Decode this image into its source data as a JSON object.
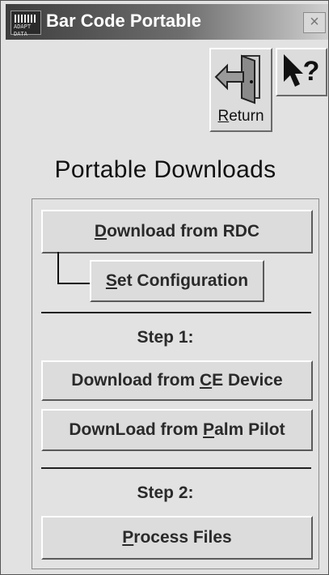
{
  "window": {
    "title": "Bar Code Portable",
    "icon_text": "ADAPT DATA",
    "close_glyph": "×"
  },
  "toolbar": {
    "return_prefix": "",
    "return_underlined": "R",
    "return_rest": "eturn",
    "help_glyph": "?"
  },
  "heading": "Portable Downloads",
  "buttons": {
    "download_rdc": {
      "underlined": "D",
      "rest": "ownload from RDC"
    },
    "set_configuration": {
      "underlined": "S",
      "rest": "et Configuration"
    },
    "download_ce": {
      "before": "Download from ",
      "underlined": "C",
      "rest": "E Device"
    },
    "download_palm": {
      "before": "DownLoad from ",
      "underlined": "P",
      "rest": "alm Pilot"
    },
    "process_files": {
      "underlined": "P",
      "rest": "rocess Files"
    }
  },
  "steps": {
    "step1": "Step 1:",
    "step2": "Step 2:"
  }
}
